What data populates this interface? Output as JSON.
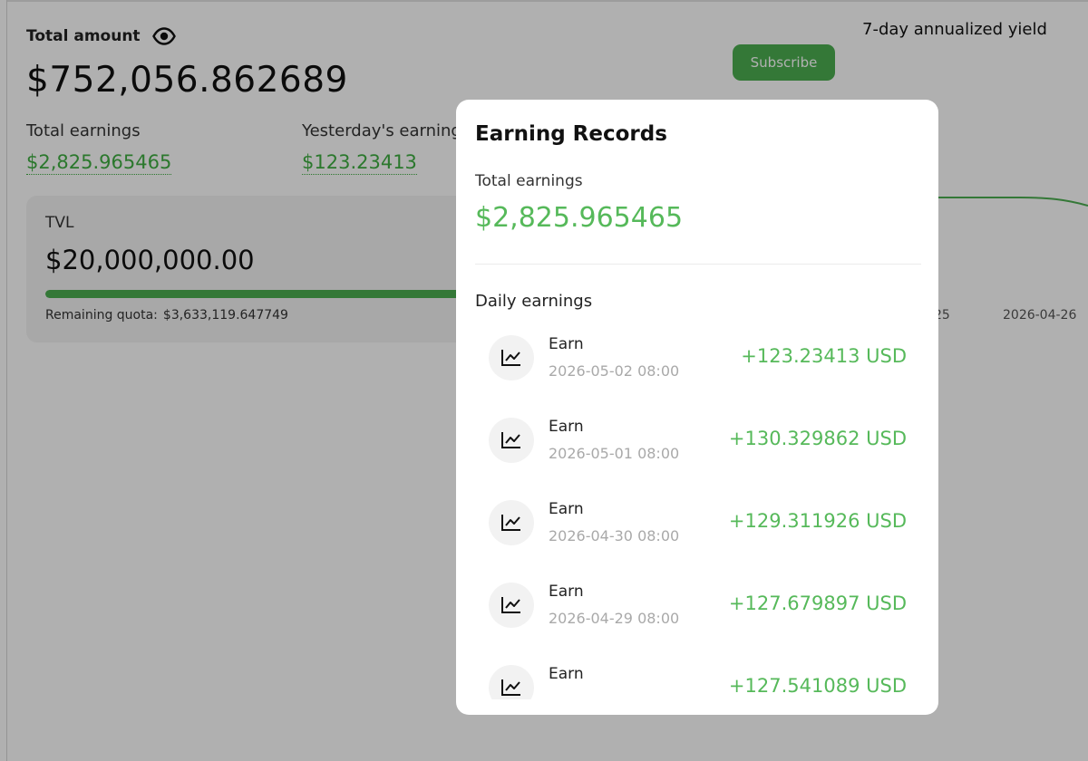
{
  "summary": {
    "total_amount_label": "Total amount",
    "total_amount_value": "$752,056.862689",
    "total_earnings_label": "Total earnings",
    "total_earnings_value": "$2,825.965465",
    "yesterday_earnings_label": "Yesterday's earnings",
    "yesterday_earnings_value": "$123.23413"
  },
  "apy_label": "7-day annualized yield",
  "subscribe_label": "Subscribe",
  "tvl": {
    "label": "TVL",
    "value": "$20,000,000.00",
    "remaining_label": "Remaining quota:",
    "remaining_value": "$3,633,119.647749",
    "progress_fraction": 0.82
  },
  "chart": {
    "tick_labels": [
      "25",
      "2026-04-26"
    ]
  },
  "modal": {
    "title": "Earning Records",
    "total_label": "Total earnings",
    "total_value": "$2,825.965465",
    "daily_label": "Daily earnings",
    "records": [
      {
        "type": "Earn",
        "time": "2026-05-02 08:00",
        "amount": "+123.23413 USD",
        "icon": "chart-icon"
      },
      {
        "type": "Earn",
        "time": "2026-05-01 08:00",
        "amount": "+130.329862 USD",
        "icon": "chart-icon"
      },
      {
        "type": "Earn",
        "time": "2026-04-30 08:00",
        "amount": "+129.311926 USD",
        "icon": "chart-icon"
      },
      {
        "type": "Earn",
        "time": "2026-04-29 08:00",
        "amount": "+127.679897 USD",
        "icon": "chart-icon"
      },
      {
        "type": "Earn",
        "time": "",
        "amount": "+127.541089 USD",
        "icon": "chart-icon"
      }
    ]
  },
  "colors": {
    "accent_green": "#56b95a",
    "button_green": "#4caf50",
    "overlay": "rgba(0,0,0,0.31)"
  }
}
